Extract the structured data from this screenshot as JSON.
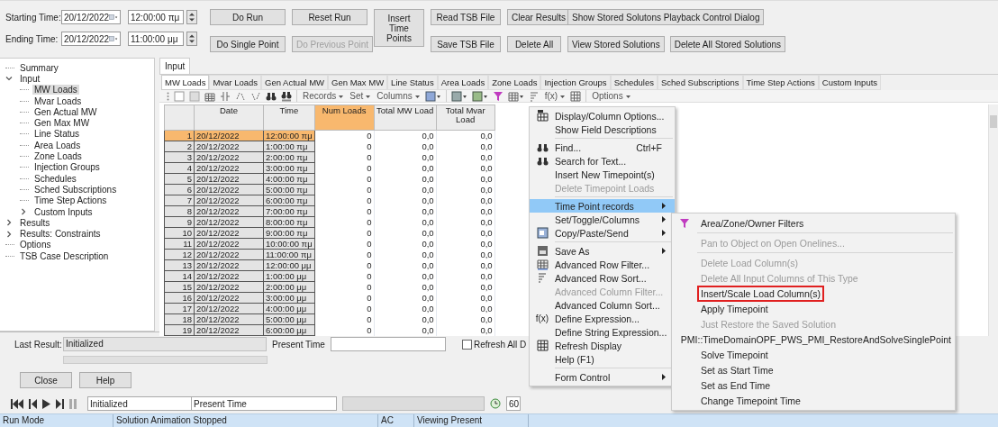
{
  "times": [
    {
      "label": "Starting Time:",
      "date": "20/12/2022",
      "time": "12:00:00 πμ"
    },
    {
      "label": "Ending Time:",
      "date": "20/12/2022",
      "time": "11:00:00 μμ"
    }
  ],
  "run_buttons": [
    [
      [
        {
          "label": "Do Run",
          "disabled": false
        }
      ],
      [
        {
          "label": "Do Single Point",
          "disabled": false
        }
      ]
    ],
    [
      [
        {
          "label": "Reset Run",
          "disabled": false
        }
      ],
      [
        {
          "label": "Do Previous Point",
          "disabled": true
        }
      ]
    ],
    [
      [
        {
          "label": "Insert Time Points",
          "disabled": false
        }
      ]
    ],
    [
      [
        {
          "label": "Read TSB File",
          "disabled": false
        }
      ],
      [
        {
          "label": "Save TSB File",
          "disabled": false
        }
      ]
    ],
    [
      [
        {
          "label": "Clear Results",
          "disabled": false
        }
      ],
      [
        {
          "label": "Delete All",
          "disabled": false
        }
      ]
    ],
    [
      [
        {
          "label": "Show Stored Solutons Playback Control Dialog",
          "disabled": false
        }
      ],
      [
        {
          "label": "View Stored Solutions",
          "disabled": false
        },
        {
          "label": "Delete All Stored Solutions",
          "disabled": false
        }
      ]
    ]
  ],
  "tree": [
    {
      "label": "Summary",
      "selected": false
    },
    {
      "label": "Input",
      "selected": false,
      "expanded": true,
      "children": [
        {
          "label": "MW Loads",
          "selected": true
        },
        {
          "label": "Mvar Loads",
          "selected": false
        },
        {
          "label": "Gen Actual MW",
          "selected": false
        },
        {
          "label": "Gen Max MW",
          "selected": false
        },
        {
          "label": "Line Status",
          "selected": false
        },
        {
          "label": "Area Loads",
          "selected": false
        },
        {
          "label": "Zone Loads",
          "selected": false
        },
        {
          "label": "Injection Groups",
          "selected": false
        },
        {
          "label": "Schedules",
          "selected": false
        },
        {
          "label": "Sched Subscriptions",
          "selected": false
        },
        {
          "label": "Time Step Actions",
          "selected": false
        },
        {
          "label": "Custom Inputs",
          "selected": false,
          "expanded": false
        }
      ]
    },
    {
      "label": "Results",
      "selected": false,
      "expanded": false
    },
    {
      "label": "Results: Constraints",
      "selected": false,
      "expanded": false
    },
    {
      "label": "Options",
      "selected": false
    },
    {
      "label": "TSB Case Description",
      "selected": false
    }
  ],
  "panel_tabs": [
    {
      "label": "Input",
      "selected": true
    }
  ],
  "sub_tabs": [
    {
      "label": "MW Loads",
      "selected": true
    },
    {
      "label": "Mvar Loads",
      "selected": false
    },
    {
      "label": "Gen Actual MW",
      "selected": false
    },
    {
      "label": "Gen Max MW",
      "selected": false
    },
    {
      "label": "Line Status",
      "selected": false
    },
    {
      "label": "Area Loads",
      "selected": false
    },
    {
      "label": "Zone Loads",
      "selected": false
    },
    {
      "label": "Injection Groups",
      "selected": false
    },
    {
      "label": "Schedules",
      "selected": false
    },
    {
      "label": "Sched Subscriptions",
      "selected": false
    },
    {
      "label": "Time Step Actions",
      "selected": false
    },
    {
      "label": "Custom Inputs",
      "selected": false
    }
  ],
  "toolbar": {
    "menus": [
      "Records",
      "Set",
      "Columns"
    ],
    "fx": "f(x)",
    "options": "Options"
  },
  "table": {
    "columns": [
      {
        "label": "Date",
        "selected": false
      },
      {
        "label": "Time",
        "selected": false
      },
      {
        "label": "Num Loads",
        "selected": true
      },
      {
        "label": "Total MW Load",
        "selected": false
      },
      {
        "label": "Total Mvar Load",
        "selected": false
      }
    ],
    "rows": [
      {
        "num": "1",
        "date": "20/12/2022",
        "time": "12:00:00 πμ",
        "num_loads": "0",
        "total_mw": "0,0",
        "total_mvar": "0,0",
        "selected": true
      },
      {
        "num": "2",
        "date": "20/12/2022",
        "time": "1:00:00 πμ",
        "num_loads": "0",
        "total_mw": "0,0",
        "total_mvar": "0,0",
        "selected": false
      },
      {
        "num": "3",
        "date": "20/12/2022",
        "time": "2:00:00 πμ",
        "num_loads": "0",
        "total_mw": "0,0",
        "total_mvar": "0,0",
        "selected": false
      },
      {
        "num": "4",
        "date": "20/12/2022",
        "time": "3:00:00 πμ",
        "num_loads": "0",
        "total_mw": "0,0",
        "total_mvar": "0,0",
        "selected": false
      },
      {
        "num": "5",
        "date": "20/12/2022",
        "time": "4:00:00 πμ",
        "num_loads": "0",
        "total_mw": "0,0",
        "total_mvar": "0,0",
        "selected": false
      },
      {
        "num": "6",
        "date": "20/12/2022",
        "time": "5:00:00 πμ",
        "num_loads": "0",
        "total_mw": "0,0",
        "total_mvar": "0,0",
        "selected": false
      },
      {
        "num": "7",
        "date": "20/12/2022",
        "time": "6:00:00 πμ",
        "num_loads": "0",
        "total_mw": "0,0",
        "total_mvar": "0,0",
        "selected": false
      },
      {
        "num": "8",
        "date": "20/12/2022",
        "time": "7:00:00 πμ",
        "num_loads": "0",
        "total_mw": "0,0",
        "total_mvar": "0,0",
        "selected": false
      },
      {
        "num": "9",
        "date": "20/12/2022",
        "time": "8:00:00 πμ",
        "num_loads": "0",
        "total_mw": "0,0",
        "total_mvar": "0,0",
        "selected": false
      },
      {
        "num": "10",
        "date": "20/12/2022",
        "time": "9:00:00 πμ",
        "num_loads": "0",
        "total_mw": "0,0",
        "total_mvar": "0,0",
        "selected": false
      },
      {
        "num": "11",
        "date": "20/12/2022",
        "time": "10:00:00 πμ",
        "num_loads": "0",
        "total_mw": "0,0",
        "total_mvar": "0,0",
        "selected": false
      },
      {
        "num": "12",
        "date": "20/12/2022",
        "time": "11:00:00 πμ",
        "num_loads": "0",
        "total_mw": "0,0",
        "total_mvar": "0,0",
        "selected": false
      },
      {
        "num": "13",
        "date": "20/12/2022",
        "time": "12:00:00 μμ",
        "num_loads": "0",
        "total_mw": "0,0",
        "total_mvar": "0,0",
        "selected": false
      },
      {
        "num": "14",
        "date": "20/12/2022",
        "time": "1:00:00 μμ",
        "num_loads": "0",
        "total_mw": "0,0",
        "total_mvar": "0,0",
        "selected": false
      },
      {
        "num": "15",
        "date": "20/12/2022",
        "time": "2:00:00 μμ",
        "num_loads": "0",
        "total_mw": "0,0",
        "total_mvar": "0,0",
        "selected": false
      },
      {
        "num": "16",
        "date": "20/12/2022",
        "time": "3:00:00 μμ",
        "num_loads": "0",
        "total_mw": "0,0",
        "total_mvar": "0,0",
        "selected": false
      },
      {
        "num": "17",
        "date": "20/12/2022",
        "time": "4:00:00 μμ",
        "num_loads": "0",
        "total_mw": "0,0",
        "total_mvar": "0,0",
        "selected": false
      },
      {
        "num": "18",
        "date": "20/12/2022",
        "time": "5:00:00 μμ",
        "num_loads": "0",
        "total_mw": "0,0",
        "total_mvar": "0,0",
        "selected": false
      },
      {
        "num": "19",
        "date": "20/12/2022",
        "time": "6:00:00 μμ",
        "num_loads": "0",
        "total_mw": "0,0",
        "total_mvar": "0,0",
        "selected": false
      }
    ]
  },
  "result_row": {
    "label": "Last Result:",
    "value": "Initialized",
    "time_label": "Present Time",
    "refresh": {
      "label": "Refresh All D",
      "checked": false
    }
  },
  "dialog_buttons": [
    "Close",
    "Help"
  ],
  "playback": {
    "status": "Initialized",
    "time": "Present Time",
    "speed": "60"
  },
  "status_bar": [
    "Run Mode",
    "Solution Animation Stopped",
    "AC",
    "Viewing Present"
  ],
  "context_menu": [
    [
      {
        "label": "Display/Column Options...",
        "disabled": false,
        "submenu": false,
        "selected": false
      },
      {
        "label": "Show Field Descriptions",
        "disabled": false,
        "submenu": false,
        "selected": false
      }
    ],
    [
      {
        "label": "Find...",
        "shortcut": "Ctrl+F",
        "disabled": false,
        "submenu": false,
        "selected": false
      },
      {
        "label": "Search for Text...",
        "disabled": false,
        "submenu": false,
        "selected": false
      },
      {
        "label": "Insert New Timepoint(s)",
        "disabled": false,
        "submenu": false,
        "selected": false
      },
      {
        "label": "Delete Timepoint Loads",
        "disabled": true,
        "submenu": false,
        "selected": false
      }
    ],
    [
      {
        "label": "Time Point records",
        "disabled": false,
        "submenu": true,
        "selected": true
      },
      {
        "label": "Set/Toggle/Columns",
        "disabled": false,
        "submenu": true,
        "selected": false
      },
      {
        "label": "Copy/Paste/Send",
        "disabled": false,
        "submenu": true,
        "selected": false
      }
    ],
    [
      {
        "label": "Save As",
        "disabled": false,
        "submenu": true,
        "selected": false
      },
      {
        "label": "Advanced Row Filter...",
        "disabled": false,
        "submenu": false,
        "selected": false
      },
      {
        "label": "Advanced Row Sort...",
        "disabled": false,
        "submenu": false,
        "selected": false
      },
      {
        "label": "Advanced Column Filter...",
        "disabled": true,
        "submenu": false,
        "selected": false
      },
      {
        "label": "Advanced Column Sort...",
        "disabled": false,
        "submenu": false,
        "selected": false
      },
      {
        "label": "Define Expression...",
        "icon_text": "f(x)",
        "disabled": false,
        "submenu": false,
        "selected": false
      },
      {
        "label": "Define String Expression...",
        "disabled": false,
        "submenu": false,
        "selected": false
      },
      {
        "label": "Refresh Display",
        "disabled": false,
        "submenu": false,
        "selected": false
      },
      {
        "label": "Help (F1)",
        "disabled": false,
        "submenu": false,
        "selected": false
      }
    ],
    [
      {
        "label": "Form Control",
        "disabled": false,
        "submenu": true,
        "selected": false
      }
    ]
  ],
  "submenu": [
    [
      {
        "label": "Area/Zone/Owner Filters",
        "disabled": false,
        "outlined": false
      }
    ],
    [
      {
        "label": "Pan to Object on Open Onelines...",
        "disabled": true,
        "outlined": false
      }
    ],
    [
      {
        "label": "Delete Load Column(s)",
        "disabled": true,
        "outlined": false
      },
      {
        "label": "Delete All Input Columns of This Type",
        "disabled": true,
        "outlined": false
      },
      {
        "label": "Insert/Scale Load Column(s)",
        "disabled": false,
        "outlined": true
      },
      {
        "label": "Apply Timepoint",
        "disabled": false,
        "outlined": false
      },
      {
        "label": "Just Restore the Saved Solution",
        "disabled": true,
        "outlined": false
      },
      {
        "label": "PMI::TimeDomainOPF_PWS_PMI_RestoreAndSolveSinglePoint",
        "disabled": false,
        "outlined": false
      },
      {
        "label": "Solve Timepoint",
        "disabled": false,
        "outlined": false
      },
      {
        "label": "Set as Start Time",
        "disabled": false,
        "outlined": false
      },
      {
        "label": "Set as End Time",
        "disabled": false,
        "outlined": false
      },
      {
        "label": "Change Timepoint Time",
        "disabled": false,
        "outlined": false
      }
    ]
  ]
}
